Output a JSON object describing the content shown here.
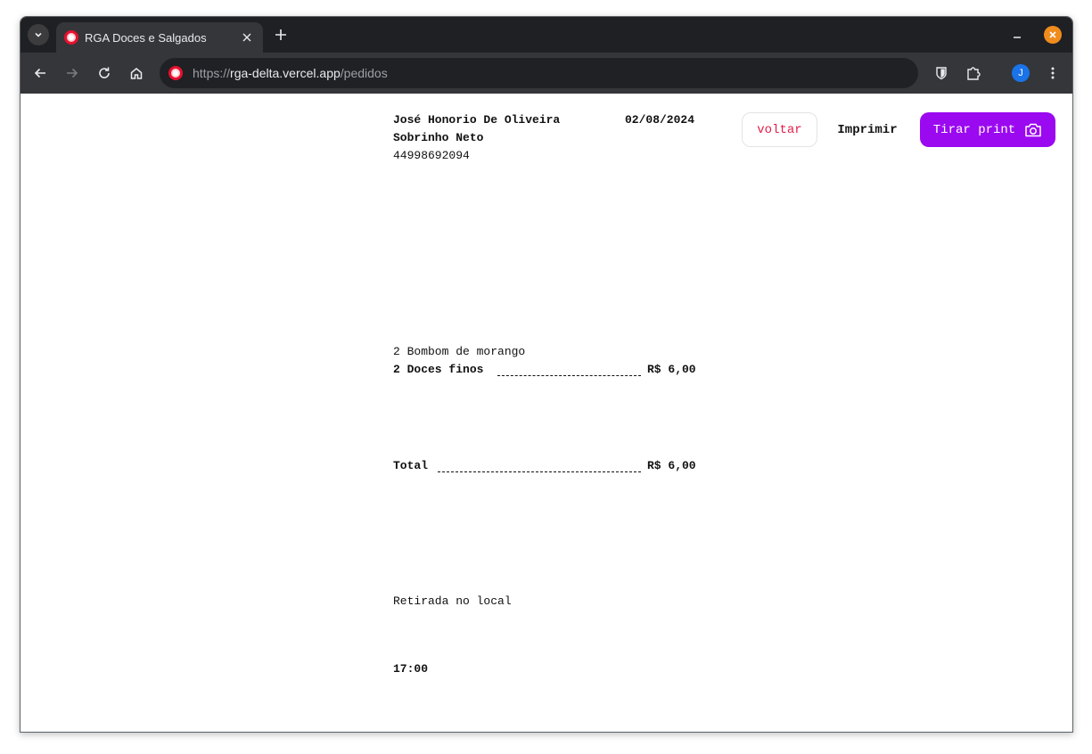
{
  "browser": {
    "tab_title": "RGA Doces e Salgados",
    "url_scheme": "https://",
    "url_host": "rga-delta.vercel.app",
    "url_path": "/pedidos",
    "profile_initial": "J"
  },
  "order": {
    "customer_name_line1": "José Honorio De Oliveira",
    "customer_name_line2": "Sobrinho Neto",
    "phone": "44998692094",
    "date": "02/08/2024",
    "items": [
      {
        "description": "2 Bombom de morango",
        "category": "2 Doces finos",
        "price": "R$ 6,00"
      }
    ],
    "total_label": "Total",
    "total_value": "R$ 6,00",
    "delivery": "Retirada no local",
    "time": "17:00"
  },
  "actions": {
    "back_label": "voltar",
    "print_label": "Imprimir",
    "screenshot_label": "Tirar print"
  },
  "colors": {
    "accent": "#9b09f0",
    "back_text": "#e11d48",
    "favicon": "#e8102e"
  }
}
